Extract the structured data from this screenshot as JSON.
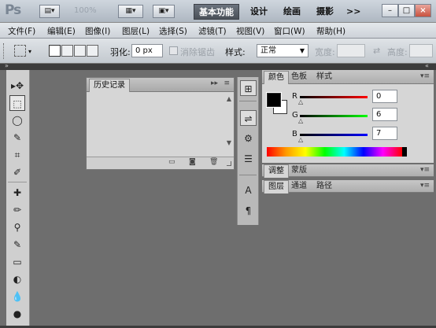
{
  "app": {
    "logo": "Ps",
    "zoom": "100%",
    "workspaces": [
      "基本功能",
      "设计",
      "绘画",
      "摄影"
    ],
    "more_label": ">>",
    "window_controls": [
      "–",
      "□",
      "×"
    ],
    "title_icons": [
      "▤▾",
      "▦▾",
      "▣▾"
    ]
  },
  "menu": [
    "文件(F)",
    "编辑(E)",
    "图像(I)",
    "图层(L)",
    "选择(S)",
    "滤镜(T)",
    "视图(V)",
    "窗口(W)",
    "帮助(H)"
  ],
  "options": {
    "feather_label": "羽化:",
    "feather_value": "0 px",
    "antialias_label": "消除锯齿",
    "style_label": "样式:",
    "style_value": "正常",
    "width_label": "宽度:",
    "height_label": "高度:"
  },
  "tools": [
    "▸✥",
    "⬚",
    "◯",
    "✎",
    "⌗",
    "✐",
    "✚",
    "✏",
    "⚲",
    "✎",
    "▭",
    "◐",
    "💧",
    "●",
    "✒"
  ],
  "history_panel": {
    "tab": "历史记录"
  },
  "color_panel": {
    "tabs": [
      "颜色",
      "色板",
      "样式"
    ],
    "channels": [
      {
        "label": "R",
        "value": "0",
        "color": "#cc0000"
      },
      {
        "label": "G",
        "value": "6",
        "color": "#00a000"
      },
      {
        "label": "B",
        "value": "7",
        "color": "#0000cc"
      }
    ]
  },
  "adjust_panel": {
    "tabs": [
      "调整",
      "蒙版"
    ]
  },
  "layers_panel": {
    "tabs": [
      "图层",
      "通道",
      "路径"
    ]
  },
  "dock_icons": [
    "⊞",
    "⇌",
    "⚙",
    "☰",
    "A",
    "¶"
  ]
}
